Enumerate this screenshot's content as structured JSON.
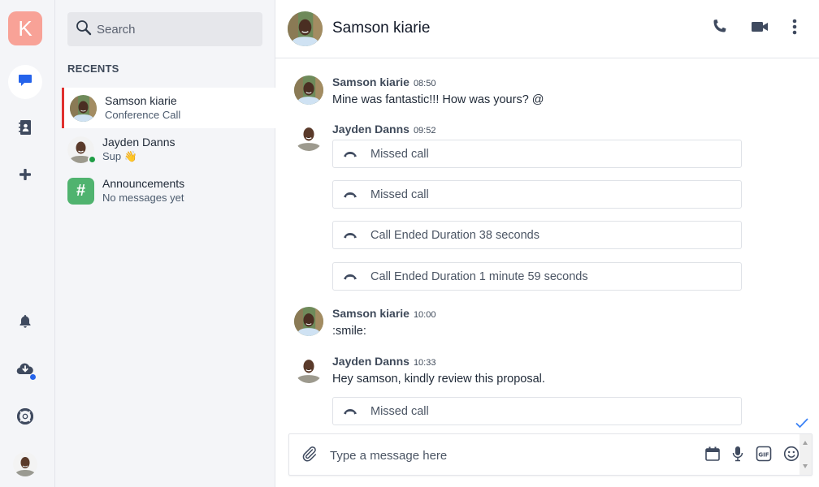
{
  "rail": {
    "logo_letter": "K",
    "logo_color": "#f8a297",
    "top_items": [
      {
        "name": "chats",
        "icon": "chat-bubble-icon",
        "active": true
      },
      {
        "name": "contacts",
        "icon": "address-book-icon",
        "active": false
      },
      {
        "name": "add",
        "icon": "plus-icon",
        "active": false
      }
    ],
    "bottom_items": [
      {
        "name": "notifications",
        "icon": "bell-icon"
      },
      {
        "name": "download",
        "icon": "cloud-download-icon",
        "badge": true
      },
      {
        "name": "help",
        "icon": "lifebuoy-icon"
      },
      {
        "name": "profile",
        "icon": "user-avatar"
      }
    ]
  },
  "sidebar": {
    "search_placeholder": "Search",
    "section_title": "RECENTS",
    "conversations": [
      {
        "name": "Samson kiarie",
        "subtitle": "Conference Call",
        "active": true,
        "online": false
      },
      {
        "name": "Jayden Danns",
        "subtitle": "Sup 👋",
        "active": false,
        "online": true
      },
      {
        "name": "Announcements",
        "subtitle": "No messages yet",
        "active": false,
        "channel": true,
        "icon": "#"
      }
    ]
  },
  "header": {
    "title": "Samson kiarie",
    "actions": [
      "phone-icon",
      "video-camera-icon",
      "more-vertical-icon"
    ]
  },
  "messages": [
    {
      "sender": "Samson kiarie",
      "time": "08:50",
      "text": "Mine was fantastic!!! How was yours? @"
    },
    {
      "sender": "Jayden Danns",
      "time": "09:52",
      "calls": [
        "Missed call",
        "Missed call",
        "Call Ended Duration 38 seconds",
        "Call Ended Duration 1 minute 59 seconds"
      ]
    },
    {
      "sender": "Samson kiarie",
      "time": "10:00",
      "text": ":smile:"
    },
    {
      "sender": "Jayden Danns",
      "time": "10:33",
      "text": "Hey samson, kindly review this proposal.",
      "calls": [
        "Missed call"
      ]
    }
  ],
  "composer": {
    "placeholder": "Type a message here",
    "icons": [
      "paperclip-icon",
      "calendar-icon",
      "microphone-icon",
      "gif-icon",
      "emoji-icon"
    ]
  },
  "colors": {
    "accent_blue": "#2563eb",
    "active_border_red": "#e0312f",
    "online_green": "#1f9d45",
    "channel_green": "#50b36f",
    "icon_slate": "#3f4a5f"
  }
}
